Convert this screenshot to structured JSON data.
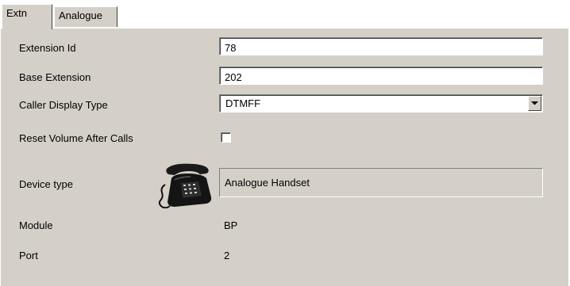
{
  "tabs": [
    {
      "label": "Extn",
      "active": true
    },
    {
      "label": "Analogue",
      "active": false
    }
  ],
  "form": {
    "extension_id": {
      "label": "Extension Id",
      "value": "78"
    },
    "base_extension": {
      "label": "Base Extension",
      "value": "202"
    },
    "caller_display_type": {
      "label": "Caller Display Type",
      "selected": "DTMFF"
    },
    "reset_volume": {
      "label": "Reset Volume After Calls",
      "checked": false
    },
    "device_type": {
      "label": "Device type",
      "icon": "telephone-icon",
      "value": "Analogue Handset"
    },
    "module": {
      "label": "Module",
      "value": "BP"
    },
    "port": {
      "label": "Port",
      "value": "2"
    }
  },
  "colors": {
    "panel": "#d4d0c8",
    "field": "#ffffff"
  }
}
